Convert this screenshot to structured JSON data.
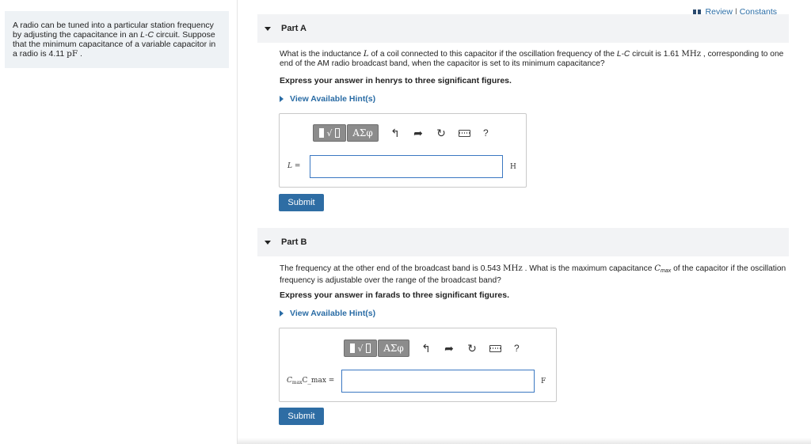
{
  "problem": {
    "text_before": "A radio can be tuned into a particular station frequency by adjusting the capacitance in an ",
    "circuit": "L-C",
    "text_middle": " circuit. Suppose that the minimum capacitance of a variable capacitor in a radio is 4.11 ",
    "unit": "pF",
    "text_end": " ."
  },
  "top_links": {
    "review": "Review",
    "separator": "|",
    "constants": "Constants"
  },
  "part_a": {
    "title": "Part A",
    "q1": "What is the inductance ",
    "q_var": "L",
    "q2": " of a coil connected to this capacitor if the oscillation frequency of the ",
    "q_circuit": "L-C",
    "q3": " circuit is 1.61 ",
    "q_unit": "MHz",
    "q4": " , corresponding to one end of the AM radio broadcast band, when the capacitor is set to its minimum capacitance?",
    "instruction": "Express your answer in henrys to three significant figures.",
    "hint": "View Available Hint(s)",
    "var_label": "L",
    "var_suffix": " =",
    "input_value": "",
    "unit": "H",
    "submit": "Submit"
  },
  "part_b": {
    "title": "Part B",
    "q1": "The frequency at the other end of the broadcast band is 0.543 ",
    "q_unit": "MHz",
    "q2": " . What is the maximum capacitance ",
    "q_var": "C",
    "q_sub": "max",
    "q3": " of the capacitor if the oscillation frequency is adjustable over the range of the broadcast band?",
    "instruction": "Express your answer in farads to three significant figures.",
    "hint": "View Available Hint(s)",
    "var_label": "C",
    "var_sub": "max",
    "var_text": "C_max =",
    "input_value": "",
    "unit": "F",
    "submit": "Submit"
  },
  "toolbar": {
    "templates_icon": "fraction-radical-icon",
    "radical": "√",
    "greek": "ΑΣφ",
    "undo_icon": "undo-icon",
    "redo_icon": "redo-icon",
    "reset_icon": "reset-icon",
    "keyboard_icon": "keyboard-icon",
    "help": "?"
  }
}
